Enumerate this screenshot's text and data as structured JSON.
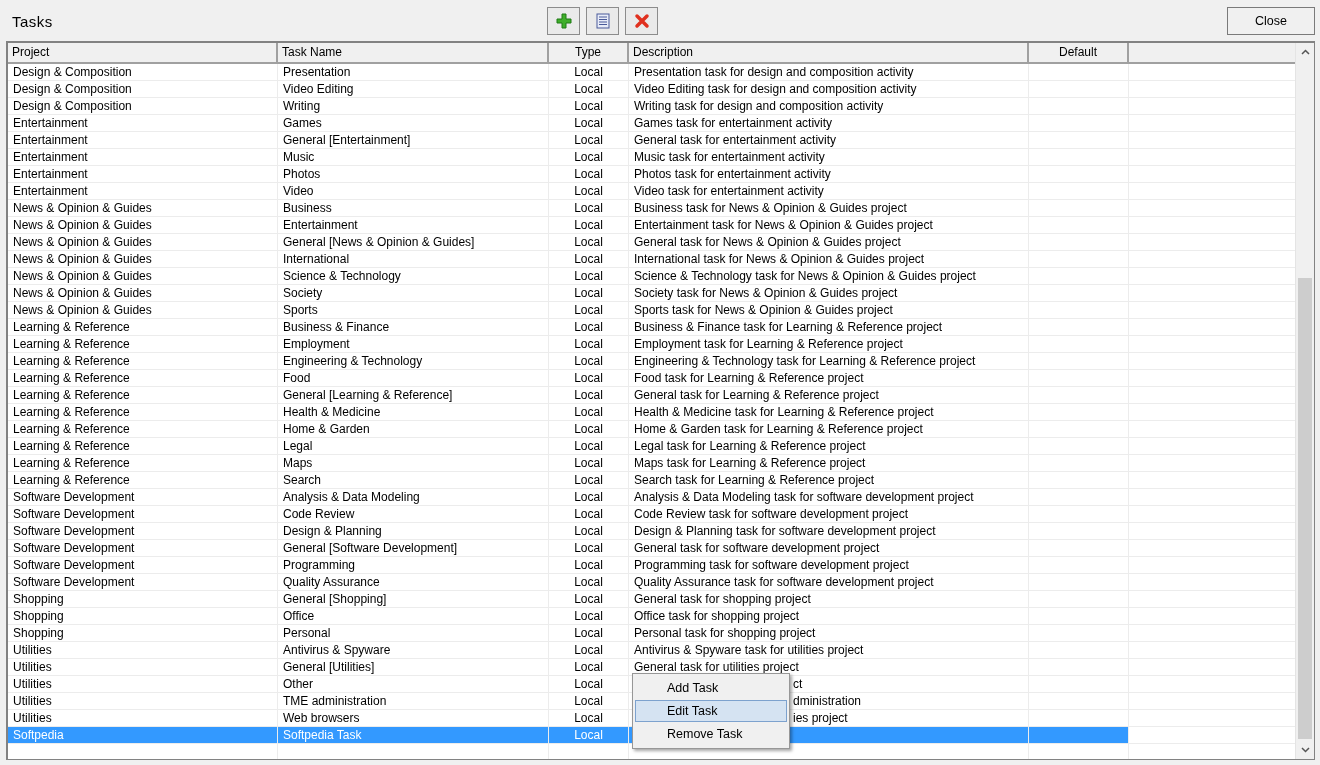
{
  "window": {
    "title": "Tasks"
  },
  "toolbar": [
    {
      "kind": "add"
    },
    {
      "kind": "edit"
    },
    {
      "kind": "delete"
    }
  ],
  "close_button": "Close",
  "table": {
    "columns": [
      "Project",
      "Task Name",
      "Type",
      "Description",
      "Default"
    ],
    "rows": [
      {
        "project": "Design & Composition",
        "task": "Presentation",
        "type": "Local",
        "description": "Presentation task for design and composition activity",
        "selected": false
      },
      {
        "project": "Design & Composition",
        "task": "Video Editing",
        "type": "Local",
        "description": "Video Editing task for design and composition activity",
        "selected": false
      },
      {
        "project": "Design & Composition",
        "task": "Writing",
        "type": "Local",
        "description": "Writing task for design and composition activity",
        "selected": false
      },
      {
        "project": "Entertainment",
        "task": "Games",
        "type": "Local",
        "description": "Games task for entertainment activity",
        "selected": false
      },
      {
        "project": "Entertainment",
        "task": "General [Entertainment]",
        "type": "Local",
        "description": "General task for entertainment activity",
        "selected": false
      },
      {
        "project": "Entertainment",
        "task": "Music",
        "type": "Local",
        "description": "Music task for entertainment activity",
        "selected": false
      },
      {
        "project": "Entertainment",
        "task": "Photos",
        "type": "Local",
        "description": "Photos task for entertainment activity",
        "selected": false
      },
      {
        "project": "Entertainment",
        "task": "Video",
        "type": "Local",
        "description": "Video task for entertainment activity",
        "selected": false
      },
      {
        "project": "News & Opinion & Guides",
        "task": "Business",
        "type": "Local",
        "description": "Business task for News & Opinion & Guides project",
        "selected": false
      },
      {
        "project": "News & Opinion & Guides",
        "task": "Entertainment",
        "type": "Local",
        "description": "Entertainment task for News & Opinion & Guides project",
        "selected": false
      },
      {
        "project": "News & Opinion & Guides",
        "task": "General [News & Opinion & Guides]",
        "type": "Local",
        "description": "General task for News & Opinion & Guides project",
        "selected": false
      },
      {
        "project": "News & Opinion & Guides",
        "task": "International",
        "type": "Local",
        "description": "International task for News & Opinion & Guides project",
        "selected": false
      },
      {
        "project": "News & Opinion & Guides",
        "task": "Science & Technology",
        "type": "Local",
        "description": "Science & Technology task for News & Opinion & Guides project",
        "selected": false
      },
      {
        "project": "News & Opinion & Guides",
        "task": "Society",
        "type": "Local",
        "description": "Society task for News & Opinion & Guides project",
        "selected": false
      },
      {
        "project": "News & Opinion & Guides",
        "task": "Sports",
        "type": "Local",
        "description": "Sports task for News & Opinion & Guides project",
        "selected": false
      },
      {
        "project": "Learning & Reference",
        "task": "Business & Finance",
        "type": "Local",
        "description": "Business & Finance task for Learning & Reference project",
        "selected": false
      },
      {
        "project": "Learning & Reference",
        "task": "Employment",
        "type": "Local",
        "description": "Employment task for Learning & Reference project",
        "selected": false
      },
      {
        "project": "Learning & Reference",
        "task": "Engineering & Technology",
        "type": "Local",
        "description": "Engineering & Technology task for Learning & Reference project",
        "selected": false
      },
      {
        "project": "Learning & Reference",
        "task": "Food",
        "type": "Local",
        "description": "Food task for Learning & Reference project",
        "selected": false
      },
      {
        "project": "Learning & Reference",
        "task": "General [Learning & Reference]",
        "type": "Local",
        "description": "General task for Learning & Reference project",
        "selected": false
      },
      {
        "project": "Learning & Reference",
        "task": "Health & Medicine",
        "type": "Local",
        "description": "Health & Medicine task for Learning & Reference project",
        "selected": false
      },
      {
        "project": "Learning & Reference",
        "task": "Home & Garden",
        "type": "Local",
        "description": "Home & Garden task for Learning & Reference project",
        "selected": false
      },
      {
        "project": "Learning & Reference",
        "task": "Legal",
        "type": "Local",
        "description": "Legal task for Learning & Reference project",
        "selected": false
      },
      {
        "project": "Learning & Reference",
        "task": "Maps",
        "type": "Local",
        "description": "Maps task for Learning & Reference project",
        "selected": false
      },
      {
        "project": "Learning & Reference",
        "task": "Search",
        "type": "Local",
        "description": "Search task for Learning & Reference project",
        "selected": false
      },
      {
        "project": "Software Development",
        "task": "Analysis & Data Modeling",
        "type": "Local",
        "description": "Analysis & Data Modeling task for software development project",
        "selected": false
      },
      {
        "project": "Software Development",
        "task": "Code Review",
        "type": "Local",
        "description": "Code Review task for software development project",
        "selected": false
      },
      {
        "project": "Software Development",
        "task": "Design & Planning",
        "type": "Local",
        "description": "Design & Planning task for software development project",
        "selected": false
      },
      {
        "project": "Software Development",
        "task": "General [Software Development]",
        "type": "Local",
        "description": "General task for software development project",
        "selected": false
      },
      {
        "project": "Software Development",
        "task": "Programming",
        "type": "Local",
        "description": "Programming task for software development project",
        "selected": false
      },
      {
        "project": "Software Development",
        "task": "Quality Assurance",
        "type": "Local",
        "description": "Quality Assurance task for software development project",
        "selected": false
      },
      {
        "project": "Shopping",
        "task": "General [Shopping]",
        "type": "Local",
        "description": "General task for shopping project",
        "selected": false
      },
      {
        "project": "Shopping",
        "task": "Office",
        "type": "Local",
        "description": "Office task for shopping project",
        "selected": false
      },
      {
        "project": "Shopping",
        "task": "Personal",
        "type": "Local",
        "description": "Personal task for shopping project",
        "selected": false
      },
      {
        "project": "Utilities",
        "task": "Antivirus & Spyware",
        "type": "Local",
        "description": "Antivirus & Spyware task for utilities project",
        "selected": false
      },
      {
        "project": "Utilities",
        "task": "General [Utilities]",
        "type": "Local",
        "description": "General task for utilities project",
        "selected": false
      },
      {
        "project": "Utilities",
        "task": "Other",
        "type": "Local",
        "description": "ct",
        "covered": true,
        "selected": false
      },
      {
        "project": "Utilities",
        "task": "TME administration",
        "type": "Local",
        "description": "dministration",
        "covered": true,
        "selected": false
      },
      {
        "project": "Utilities",
        "task": "Web browsers",
        "type": "Local",
        "description": "ies project",
        "covered": true,
        "selected": false
      },
      {
        "project": "Softpedia",
        "task": "Softpedia Task",
        "type": "Local",
        "selected": true
      }
    ]
  },
  "context_menu": [
    {
      "label": "Add Task",
      "selected": false
    },
    {
      "label": "Edit Task",
      "selected": true
    },
    {
      "label": "Remove Task",
      "selected": false
    }
  ]
}
